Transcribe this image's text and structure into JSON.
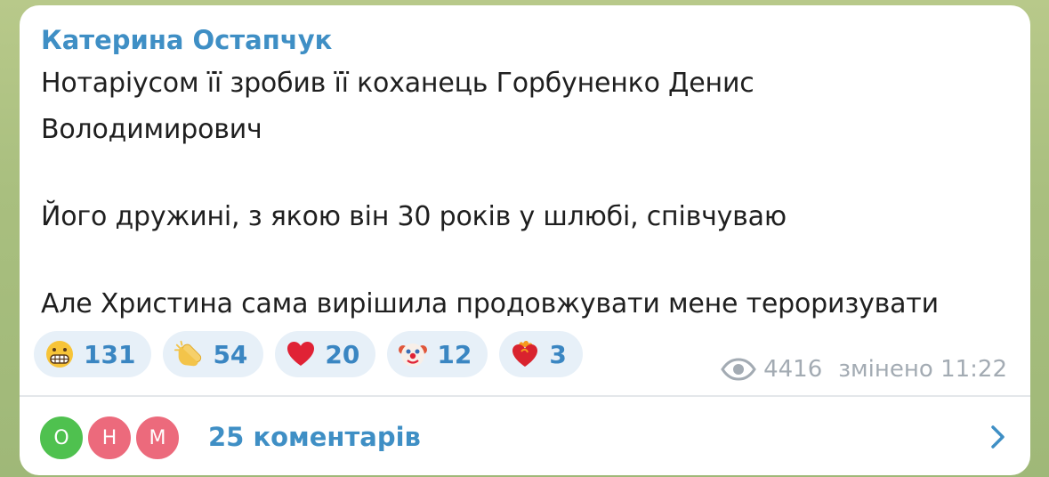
{
  "post": {
    "author": "Катерина Остапчук",
    "lines": [
      "Нотаріусом її зробив її коханець Горбуненко Денис",
      "Володимирович",
      "Його дружині, з якою він 30 років у шлюбі, співчуваю",
      "Але Христина сама вирішила продовжувати мене тероризувати"
    ]
  },
  "reactions": [
    {
      "icon": "grimacing-face-emoji",
      "count": "131"
    },
    {
      "icon": "clapping-hands-emoji",
      "count": "54"
    },
    {
      "icon": "red-heart-emoji",
      "count": "20"
    },
    {
      "icon": "clown-face-emoji",
      "count": "12"
    },
    {
      "icon": "heart-on-fire-emoji",
      "count": "3"
    }
  ],
  "meta": {
    "views": "4416",
    "edited_time": "змінено 11:22",
    "views_icon": "eye-icon"
  },
  "comments": {
    "avatars": [
      "О",
      "Н",
      "М"
    ],
    "label": "25 коментарів",
    "chevron_icon": "chevron-right-icon"
  },
  "colors": {
    "accent": "#3f8fc5",
    "reaction_bg": "#e7f0f8",
    "meta_text": "#a3abb3",
    "avatar_green": "#4fc14f",
    "avatar_pink": "#ec6a7c"
  }
}
